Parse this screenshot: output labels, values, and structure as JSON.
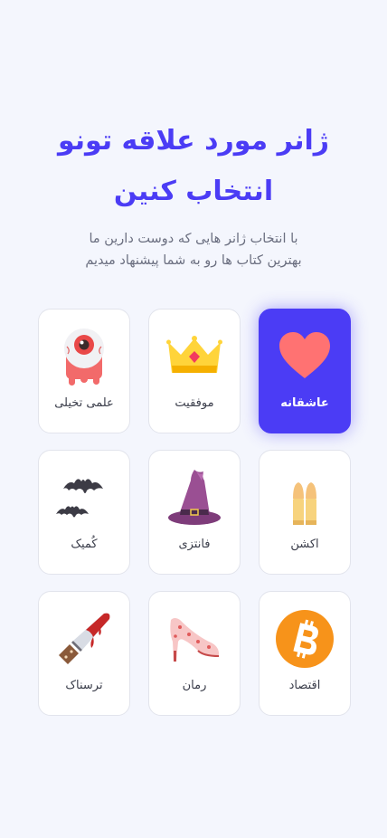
{
  "header": {
    "title_line1": "ژانر مورد علاقه تونو",
    "title_line2": "انتخاب کنین",
    "subtitle_line1": "با انتخاب ژانر هایی که دوست دارین ما",
    "subtitle_line2": "بهترین کتاب ها رو به شما پیشنهاد میدیم"
  },
  "genres": [
    {
      "label": "عاشقانه",
      "icon": "heart-icon",
      "selected": true
    },
    {
      "label": "موفقیت",
      "icon": "crown-icon",
      "selected": false
    },
    {
      "label": "علمی تخیلی",
      "icon": "eyeball-monster-icon",
      "selected": false
    },
    {
      "label": "اکشن",
      "icon": "bullets-icon",
      "selected": false
    },
    {
      "label": "فانتزی",
      "icon": "witch-hat-icon",
      "selected": false
    },
    {
      "label": "کُمیک",
      "icon": "bats-icon",
      "selected": false
    },
    {
      "label": "اقتصاد",
      "icon": "bitcoin-icon",
      "selected": false
    },
    {
      "label": "رمان",
      "icon": "high-heel-icon",
      "selected": false
    },
    {
      "label": "ترسناک",
      "icon": "bloody-knife-icon",
      "selected": false
    }
  ],
  "colors": {
    "accent": "#4B3CF5",
    "background": "#F4F6FD"
  }
}
